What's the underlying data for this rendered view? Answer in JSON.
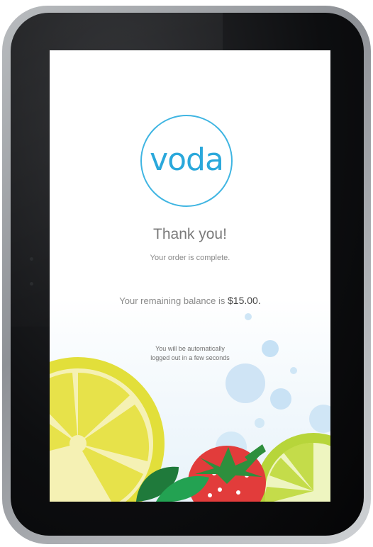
{
  "brand": {
    "logo_text": "voda",
    "accent": "#2aa8db"
  },
  "confirmation": {
    "title": "Thank you!",
    "subtitle": "Your order is complete.",
    "balance_prefix": "Your remaining balance is ",
    "balance_amount": "$15.00.",
    "logout_line1": "You will be automatically",
    "logout_line2": "logged out in a few seconds"
  }
}
